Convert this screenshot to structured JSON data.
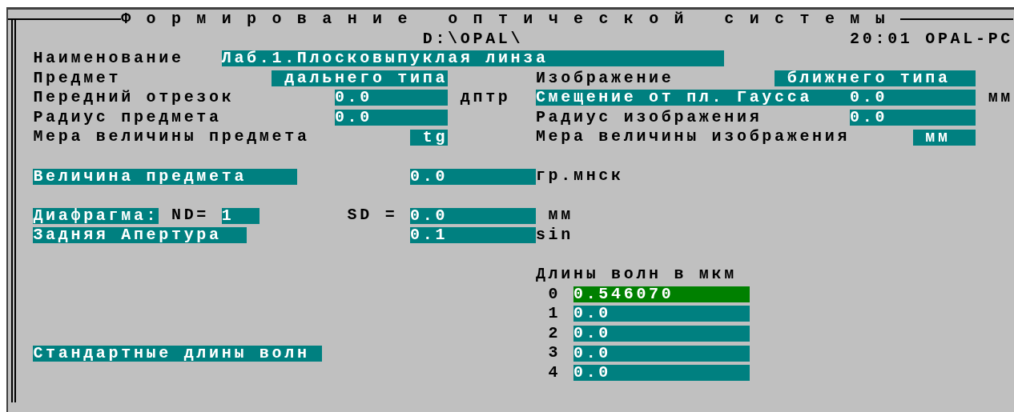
{
  "window": {
    "title": "Формирование оптической системы",
    "path": "D:\\OPAL\\",
    "time": "20:01",
    "computer": "OPAL-PC"
  },
  "name": {
    "label": "Наименование",
    "value": "Лаб.1.Плосковыпуклая линза"
  },
  "object": {
    "label": "Предмет",
    "type": "дальнего типа",
    "front_segment": {
      "label": "Передний отрезок",
      "value": "0.0",
      "unit": "дптр"
    },
    "radius": {
      "label": "Радиус предмета",
      "value": "0.0"
    },
    "size_measure": {
      "label": "Мера величины предмета",
      "value": "tg"
    },
    "size": {
      "label": "Величина предмета",
      "value": "0.0",
      "unit": "гр.мнск"
    }
  },
  "image": {
    "label": "Изображение",
    "type": "ближнего типа",
    "gauss_shift": {
      "label": "Смещение от пл. Гаусса",
      "value": "0.0",
      "unit": "мм"
    },
    "radius": {
      "label": "Радиус изображения",
      "value": "0.0"
    },
    "size_measure": {
      "label": "Мера величины изображения",
      "value": "мм"
    }
  },
  "diaphragm": {
    "label": "Диафрагма:",
    "nd_label": "ND=",
    "nd_value": "1",
    "sd_label": "SD =",
    "sd_value": "0.0",
    "sd_unit": "мм"
  },
  "rear_aperture": {
    "label": "Задняя Апертура",
    "value": "0.1",
    "unit": "sin"
  },
  "wavelengths": {
    "title": "Длины волн в мкм",
    "items": [
      {
        "index": "0",
        "value": "0.546070",
        "selected": true
      },
      {
        "index": "1",
        "value": "0.0",
        "selected": false
      },
      {
        "index": "2",
        "value": "0.0",
        "selected": false
      },
      {
        "index": "3",
        "value": "0.0",
        "selected": false
      },
      {
        "index": "4",
        "value": "0.0",
        "selected": false
      }
    ]
  },
  "standard_wavelengths_button": "Стандартные длины волн"
}
